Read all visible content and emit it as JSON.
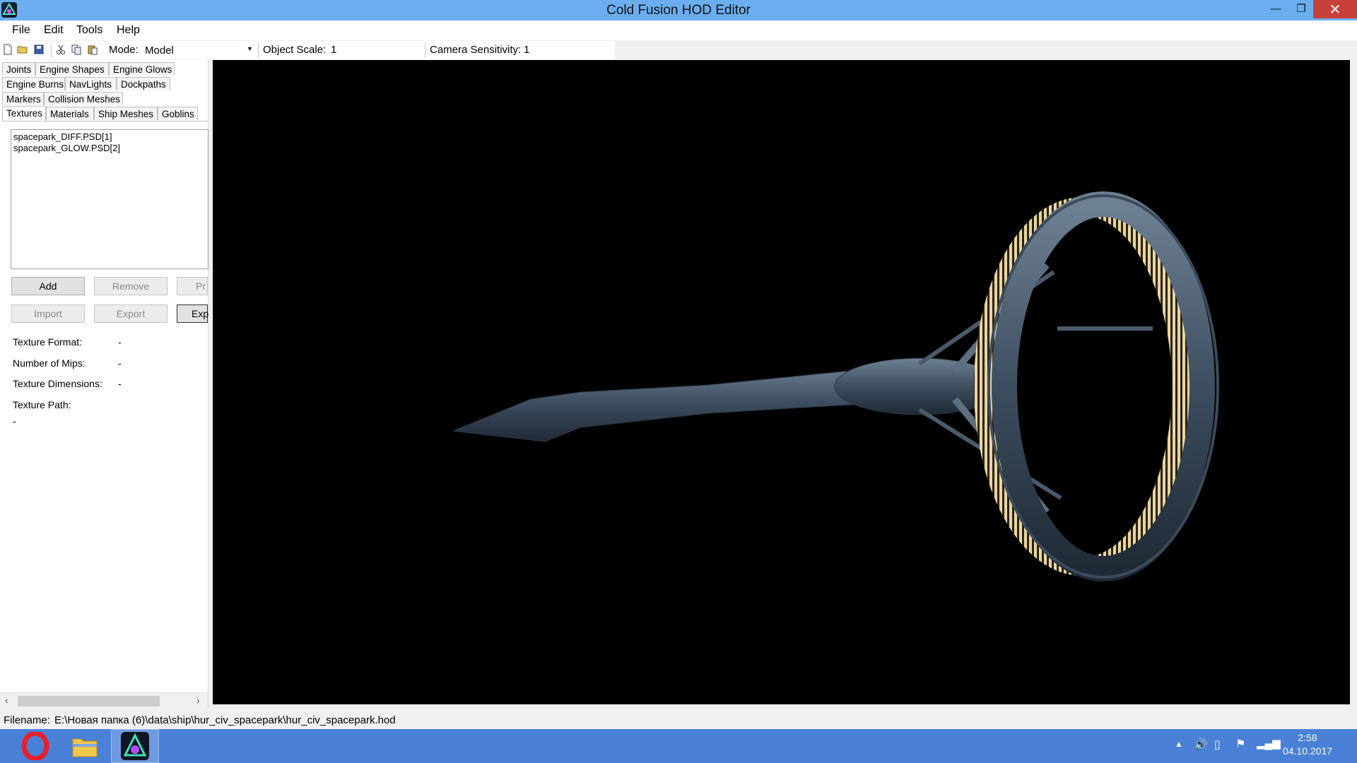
{
  "window": {
    "title": "Cold Fusion HOD Editor",
    "minimize_glyph": "—",
    "maximize_glyph": "❐",
    "close_glyph": "✕"
  },
  "menu": [
    "File",
    "Edit",
    "Tools",
    "Help"
  ],
  "toolbar": {
    "mode_label": "Mode:",
    "mode_value": "Model",
    "object_scale_label": "Object Scale:",
    "object_scale_value": "1",
    "camera_sensitivity_label": "Camera Sensitivity:",
    "camera_sensitivity_value": "1",
    "icons": [
      "new-file-icon",
      "open-folder-icon",
      "save-icon",
      "cut-icon",
      "copy-icon",
      "paste-icon"
    ]
  },
  "tabs": {
    "row1": [
      "Joints",
      "Engine Shapes",
      "Engine Glows"
    ],
    "row2": [
      "Engine Burns",
      "NavLights",
      "Dockpaths"
    ],
    "row3": [
      "Markers",
      "Collision Meshes"
    ],
    "row4": [
      "Textures",
      "Materials",
      "Ship Meshes",
      "Goblins"
    ],
    "active": "Textures"
  },
  "texture_list": [
    "spacepark_DIFF.PSD[1]",
    "spacepark_GLOW.PSD[2]"
  ],
  "buttons": {
    "add": "Add",
    "remove": "Remove",
    "pr_partial": "Pr",
    "import": "Import",
    "export": "Export",
    "exp_partial": "Exp"
  },
  "properties": {
    "texture_format_label": "Texture Format:",
    "texture_format_value": "-",
    "number_of_mips_label": "Number of Mips:",
    "number_of_mips_value": "-",
    "texture_dimensions_label": "Texture Dimensions:",
    "texture_dimensions_value": "-",
    "texture_path_label": "Texture Path:",
    "texture_path_value": "-"
  },
  "status": {
    "filename_label": "Filename:",
    "filename_value": "E:\\Новая папка (6)\\data\\ship\\hur_civ_spacepark\\hur_civ_spacepark.hod"
  },
  "taskbar": {
    "apps": [
      "opera-icon",
      "file-explorer-icon",
      "cold-fusion-icon"
    ],
    "time": "2:58",
    "date": "04.10.2017"
  },
  "colors": {
    "titlebar": "#6aaef0",
    "close_button": "#c7413a",
    "taskbar": "#4a80d6",
    "viewport": "#000000"
  }
}
